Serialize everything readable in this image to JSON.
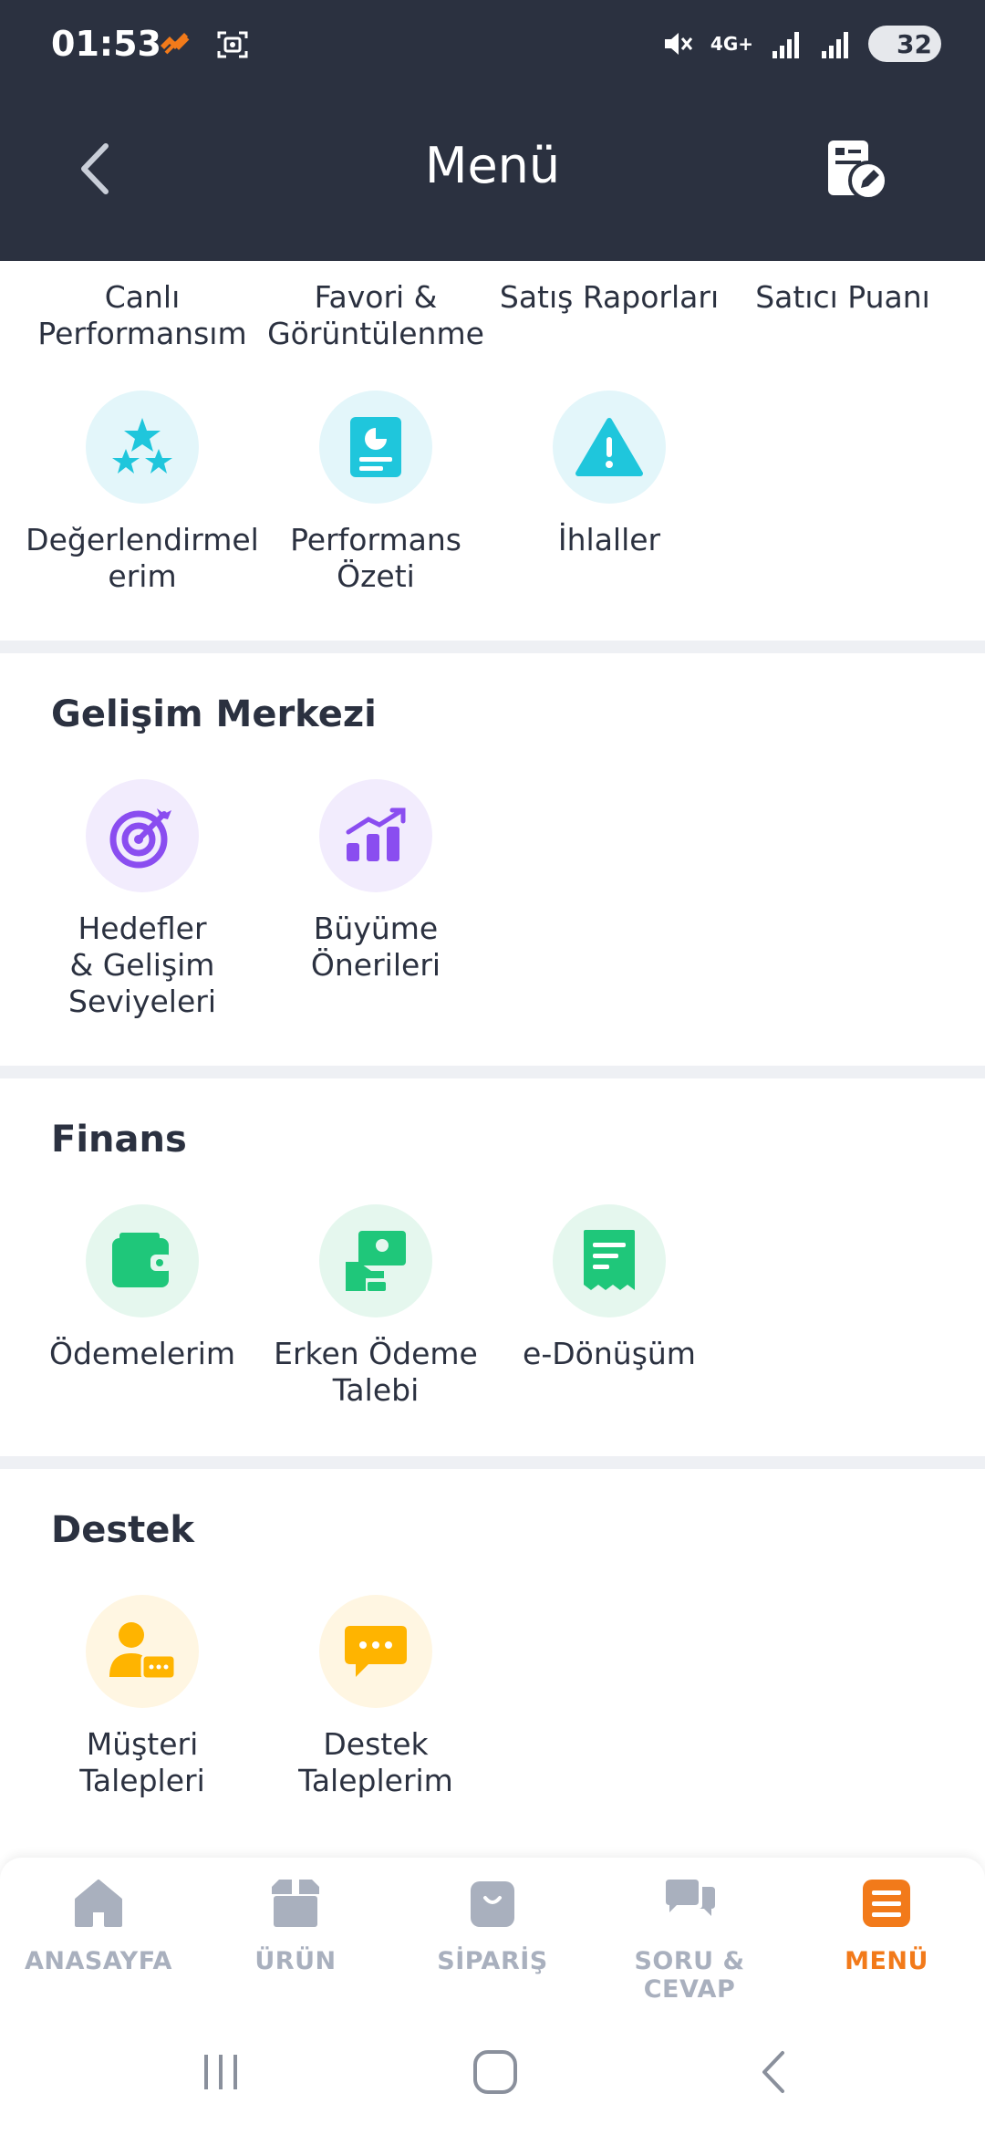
{
  "status_bar": {
    "time": "01:53",
    "network": "4G+",
    "battery": "32"
  },
  "header": {
    "title": "Menü"
  },
  "top_row": [
    {
      "label": "Canlı\nPerformansım"
    },
    {
      "label": "Favori &\nGörüntülenme"
    },
    {
      "label": "Satış Raporları"
    },
    {
      "label": "Satıcı Puanı"
    }
  ],
  "performance_items": [
    {
      "label": "Değerlendirmel\nerim",
      "icon": "stars-icon"
    },
    {
      "label": "Performans\nÖzeti",
      "icon": "report-icon"
    },
    {
      "label": "İhlaller",
      "icon": "warning-icon"
    }
  ],
  "gelisim": {
    "title": "Gelişim Merkezi",
    "items": [
      {
        "label": "Hedefler\n& Gelişim\nSeviyeleri",
        "icon": "target-icon"
      },
      {
        "label": "Büyüme\nÖnerileri",
        "icon": "growth-chart-icon"
      }
    ]
  },
  "finans": {
    "title": "Finans",
    "items": [
      {
        "label": "Ödemelerim",
        "icon": "wallet-icon"
      },
      {
        "label": "Erken Ödeme\nTalebi",
        "icon": "early-payment-icon"
      },
      {
        "label": "e-Dönüşüm",
        "icon": "e-document-icon"
      }
    ]
  },
  "destek": {
    "title": "Destek",
    "items": [
      {
        "label": "Müşteri Talepleri",
        "icon": "customer-chat-icon"
      },
      {
        "label": "Destek\nTaleplerim",
        "icon": "support-chat-icon"
      }
    ]
  },
  "bottom_nav": [
    {
      "label": "ANASAYFA",
      "icon": "home-icon",
      "active": false
    },
    {
      "label": "ÜRÜN",
      "icon": "box-icon",
      "active": false
    },
    {
      "label": "SİPARİŞ",
      "icon": "bag-icon",
      "active": false
    },
    {
      "label": "SORU & CEVAP",
      "icon": "chat-icon",
      "active": false
    },
    {
      "label": "MENÜ",
      "icon": "menu-icon",
      "active": true
    }
  ],
  "colors": {
    "header_bg": "#2b3140",
    "teal": "#1fc6dc",
    "purple": "#8a4df0",
    "green": "#1fc77a",
    "yellow": "#ffb400",
    "active_orange": "#f27a1a",
    "inactive_nav": "#a9b0be"
  }
}
